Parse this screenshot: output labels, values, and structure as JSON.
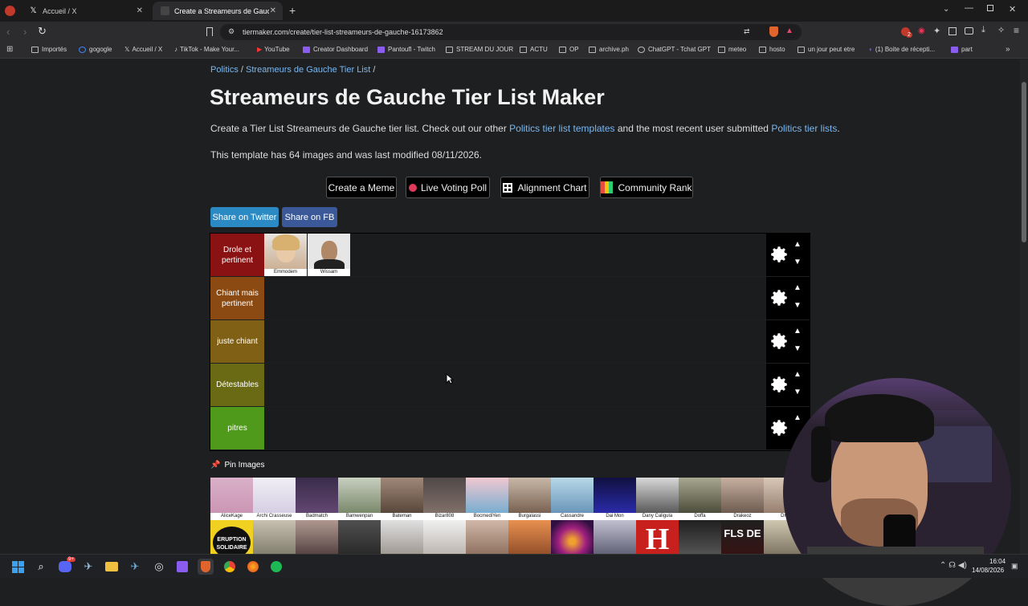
{
  "browser": {
    "tabs": [
      {
        "title": "Accueil / X",
        "active": false
      },
      {
        "title": "Create a Streameurs de Gauche",
        "active": true
      }
    ],
    "new_tab": "+",
    "url": "tiermaker.com/create/tier-list-streameurs-de-gauche-16173862",
    "extension_badge": "2",
    "bookmarks": [
      "Importés",
      "gogogle",
      "Accueil / X",
      "TikTok - Make Your...",
      "YouTube",
      "Creator Dashboard",
      "Pantoufl - Twitch",
      "STREAM DU JOUR",
      "ACTU",
      "OP",
      "archive.ph",
      "ChatGPT - Tchat GPT",
      "meteo",
      "hosto",
      "un jour peut etre",
      "(1) Boite de récepti...",
      "part"
    ]
  },
  "page": {
    "breadcrumb": {
      "category": "Politics",
      "sep1": " / ",
      "current": "Streameurs de Gauche Tier List",
      "sep2": " /"
    },
    "title": "Streameurs de Gauche Tier List Maker",
    "intro": {
      "prefix": "Create a Tier List Streameurs de Gauche tier list. Check out our other ",
      "link1": "Politics tier list templates",
      "middle": " and the most recent user submitted ",
      "link2": "Politics tier lists",
      "suffix": "."
    },
    "template_info": "This template has 64 images and was last modified 08/11/2026.",
    "actions": {
      "meme": "Create a Meme",
      "poll": "Live Voting Poll",
      "alignment": "Alignment Chart",
      "community": "Community Rank"
    },
    "share": {
      "twitter": "Share on Twitter",
      "fb": "Share on FB"
    },
    "tiers": [
      {
        "label": "Drole et pertinent",
        "color": "#8b1212",
        "items": [
          "Emmodem",
          "Wissam"
        ]
      },
      {
        "label": "Chiant mais pertinent",
        "color": "#8b4a12",
        "items": []
      },
      {
        "label": "juste chiant",
        "color": "#806014",
        "items": []
      },
      {
        "label": "Détestables",
        "color": "#6a6a14",
        "items": []
      },
      {
        "label": "pitres",
        "color": "#4f9a1a",
        "items": []
      }
    ],
    "pin_label": "Pin Images",
    "pool_row1": [
      "AliceKage",
      "Archi Crasseuse",
      "Badmatch",
      "Bamwenpan",
      "Bateman",
      "Bizar808",
      "BocmediYen",
      "Burgalassi",
      "Cassandre",
      "Dai Mon",
      "Dany Caligula",
      "Doffa",
      "Drakeoz",
      "Drum"
    ],
    "pool_row2_labels": [
      "ERUPTION SOLIDAIRE",
      "H",
      "FLS DE"
    ],
    "colors": {
      "link": "#7ab7f0",
      "twitter": "#2b8ac4",
      "fb": "#3b5998"
    }
  },
  "taskbar": {
    "time": "16:04",
    "date": "14/08/2026",
    "discord_badge": "9+"
  }
}
